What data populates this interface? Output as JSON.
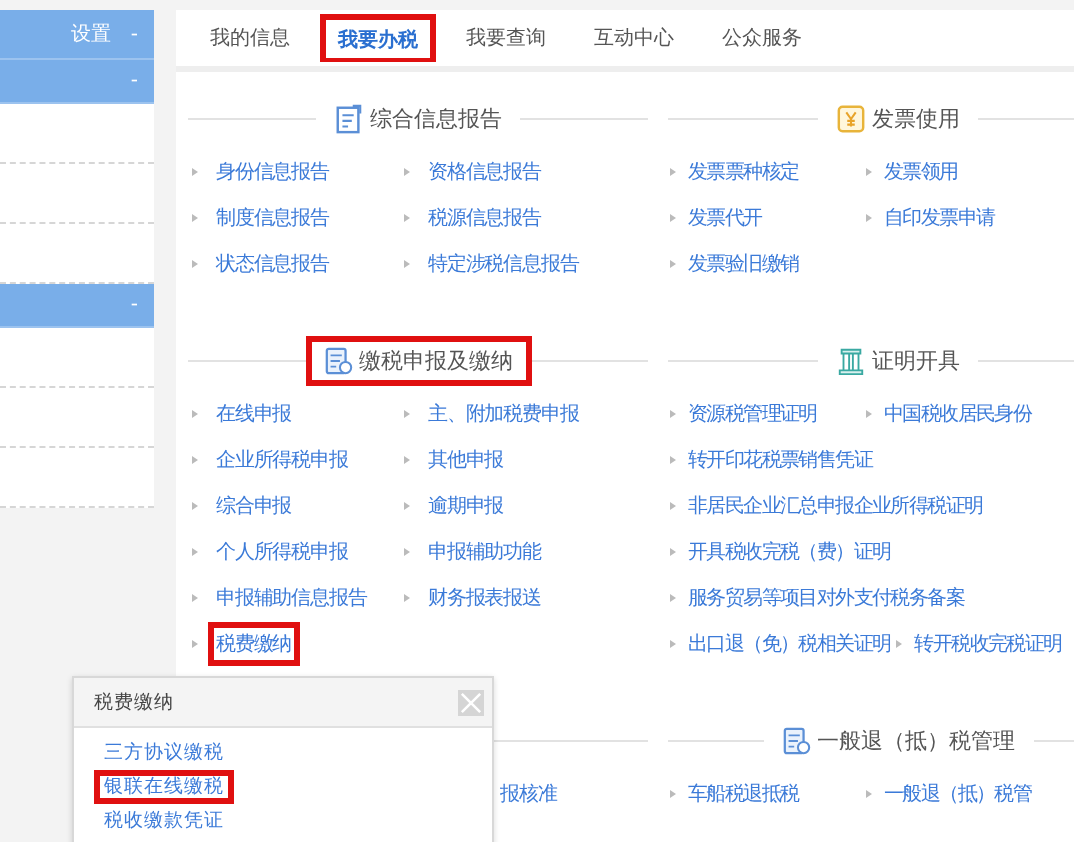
{
  "sidebar": {
    "groups": [
      {
        "title": "设置",
        "toggle": "-"
      },
      {
        "toggle": "-"
      },
      {
        "toggle": "-"
      }
    ]
  },
  "tabs": [
    {
      "label": "我的信息",
      "selected": false,
      "highlighted": false
    },
    {
      "label": "我要办税",
      "selected": true,
      "highlighted": true
    },
    {
      "label": "我要查询",
      "selected": false,
      "highlighted": false
    },
    {
      "label": "互动中心",
      "selected": false,
      "highlighted": false
    },
    {
      "label": "公众服务",
      "selected": false,
      "highlighted": false
    }
  ],
  "sections": [
    {
      "left": {
        "title": "综合信息报告",
        "highlighted": false,
        "rows": [
          [
            {
              "label": "身份信息报告",
              "highlighted": false
            },
            {
              "label": "资格信息报告",
              "highlighted": false
            }
          ],
          [
            {
              "label": "制度信息报告",
              "highlighted": false
            },
            {
              "label": "税源信息报告",
              "highlighted": false
            }
          ],
          [
            {
              "label": "状态信息报告",
              "highlighted": false
            },
            {
              "label": "特定涉税信息报告",
              "highlighted": false
            }
          ]
        ]
      },
      "right": {
        "title": "发票使用",
        "highlighted": false,
        "rows": [
          [
            {
              "label": "发票票种核定",
              "highlighted": false
            },
            {
              "label": "发票领用",
              "highlighted": false
            }
          ],
          [
            {
              "label": "发票代开",
              "highlighted": false
            },
            {
              "label": "自印发票申请",
              "highlighted": false
            }
          ],
          [
            {
              "label": "发票验旧缴销",
              "highlighted": false
            }
          ]
        ]
      }
    },
    {
      "left": {
        "title": "缴税申报及缴纳",
        "highlighted": true,
        "rows": [
          [
            {
              "label": "在线申报",
              "highlighted": false
            },
            {
              "label": "主、附加税费申报",
              "highlighted": false
            }
          ],
          [
            {
              "label": "企业所得税申报",
              "highlighted": false
            },
            {
              "label": "其他申报",
              "highlighted": false
            }
          ],
          [
            {
              "label": "综合申报",
              "highlighted": false
            },
            {
              "label": "逾期申报",
              "highlighted": false
            }
          ],
          [
            {
              "label": "个人所得税申报",
              "highlighted": false
            },
            {
              "label": "申报辅助功能",
              "highlighted": false
            }
          ],
          [
            {
              "label": "申报辅助信息报告",
              "highlighted": false
            },
            {
              "label": "财务报表报送",
              "highlighted": false
            }
          ],
          [
            {
              "label": "税费缴纳",
              "highlighted": true
            }
          ]
        ]
      },
      "right": {
        "title": "证明开具",
        "highlighted": false,
        "rows": [
          [
            {
              "label": "资源税管理证明",
              "highlighted": false
            },
            {
              "label": "中国税收居民身份",
              "highlighted": false
            }
          ],
          [
            {
              "label": "转开印花税票销售凭证",
              "highlighted": false
            }
          ],
          [
            {
              "label": "非居民企业汇总申报企业所得税证明",
              "highlighted": false
            }
          ],
          [
            {
              "label": "开具税收完税（费）证明",
              "highlighted": false
            }
          ],
          [
            {
              "label": "服务贸易等项目对外支付税务备案",
              "highlighted": false
            }
          ],
          [
            {
              "label": "出口退（免）税相关证明",
              "highlighted": false
            },
            {
              "label": "转开税收完税证明",
              "highlighted": false
            }
          ]
        ]
      }
    },
    {
      "left": {
        "rows": [
          [
            {
              "label": "报核准",
              "highlighted": false,
              "kind": "partial"
            }
          ]
        ]
      },
      "right": {
        "title": "一般退（抵）税管理",
        "highlighted": false,
        "rows": [
          [
            {
              "label": "车船税退抵税",
              "highlighted": false
            },
            {
              "label": "一般退（抵）税管",
              "highlighted": false
            }
          ]
        ]
      }
    }
  ],
  "popup": {
    "title": "税费缴纳",
    "items": [
      {
        "label": "三方协议缴税",
        "highlighted": false
      },
      {
        "label": "银联在线缴税",
        "highlighted": true
      },
      {
        "label": "税收缴款凭证",
        "highlighted": false
      }
    ]
  }
}
